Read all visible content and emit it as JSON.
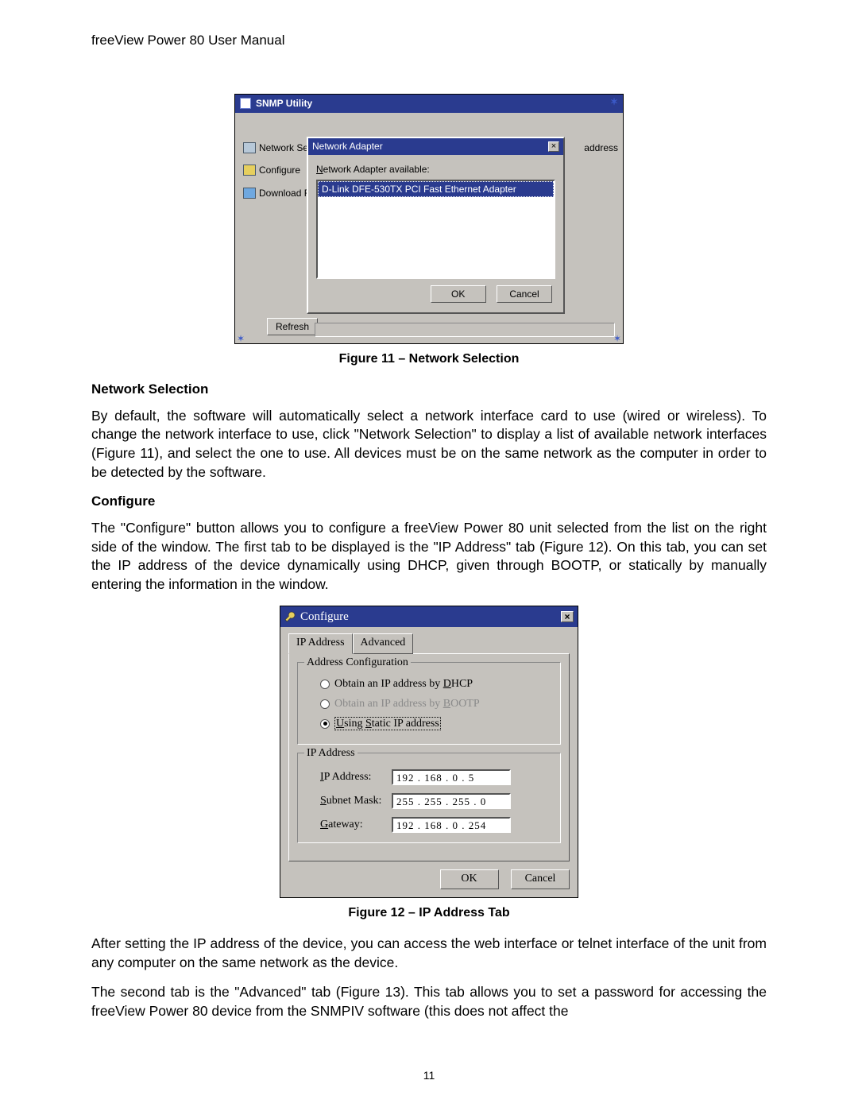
{
  "doc": {
    "running_head": "freeView Power 80 User Manual",
    "page_number": "11"
  },
  "fig11": {
    "caption": "Figure 11 – Network Selection",
    "window_title": "SNMP Utility",
    "sidebar": {
      "network_se": "Network Se",
      "configure": "Configure",
      "download_f": "Download F"
    },
    "header_address": "address",
    "refresh_label": "Refresh",
    "dialog": {
      "title": "Network Adapter",
      "label": "Network Adapter available:",
      "item": "D-Link DFE-530TX PCI Fast Ethernet Adapter",
      "ok": "OK",
      "cancel": "Cancel"
    }
  },
  "sec_network": {
    "heading": "Network Selection",
    "para": "By default, the software will automatically select a network interface card to use (wired or wireless). To change the network interface to use, click \"Network Selection\" to display a list of available network interfaces (Figure 11), and select the one to use. All devices must be on the same network as the computer in order to be detected by the software."
  },
  "sec_configure": {
    "heading": "Configure",
    "para": "The \"Configure\" button allows you to configure a freeView Power 80 unit selected from the list on the right side of the window.  The first tab to be displayed is the \"IP Address\" tab (Figure 12). On this tab, you can set the IP address of the device dynamically using DHCP, given through BOOTP, or statically by manually entering the information in the window."
  },
  "fig12": {
    "caption": "Figure 12 – IP Address Tab",
    "window_title": "Configure",
    "tabs": {
      "ip_address": "IP Address",
      "advanced": "Advanced"
    },
    "group_addr": {
      "legend": "Address Configuration",
      "opt_dhcp_pre": "Obtain an IP address by ",
      "opt_dhcp_u": "D",
      "opt_dhcp_post": "HCP",
      "opt_bootp_pre": "Obtain an IP address by ",
      "opt_bootp_u": "B",
      "opt_bootp_post": "OOTP",
      "opt_static_u": "U",
      "opt_static_mid": "S",
      "opt_static_text": "sing Static IP address"
    },
    "group_ip": {
      "legend": "IP Address",
      "ip_label": "IP Address:",
      "ip_value": "192 . 168 .   0  .   5",
      "mask_label": "Subnet Mask:",
      "mask_value": "255 . 255 . 255 .   0",
      "gw_label": "Gateway:",
      "gw_value": "192 . 168 .   0  . 254"
    },
    "ok": "OK",
    "cancel": "Cancel"
  },
  "after_fig12": {
    "para1": "After setting the IP address of the device, you can access the web interface or telnet interface of the unit from any computer on the same network as the device.",
    "para2": "The second tab is the \"Advanced\" tab (Figure 13). This tab allows you to set a password for accessing the freeView Power 80 device from the SNMPIV software (this does not affect the"
  }
}
